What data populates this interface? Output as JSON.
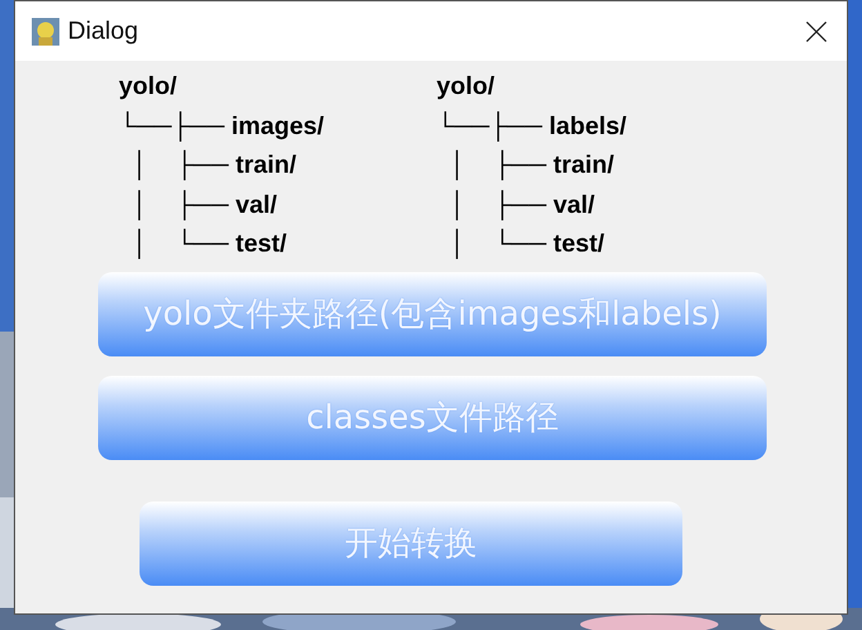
{
  "window": {
    "title": "Dialog"
  },
  "trees": [
    {
      "lines": [
        "yolo/",
        "└──├── images/",
        "  │    ├── train/",
        "  │    ├── val/",
        "  │    └── test/"
      ]
    },
    {
      "lines": [
        "yolo/",
        "└──├── labels/",
        "  │    ├── train/",
        "  │    ├── val/",
        "  │    └── test/"
      ]
    }
  ],
  "buttons": [
    "yolo文件夹路径(包含images和labels)",
    "classes文件路径",
    "开始转换"
  ]
}
